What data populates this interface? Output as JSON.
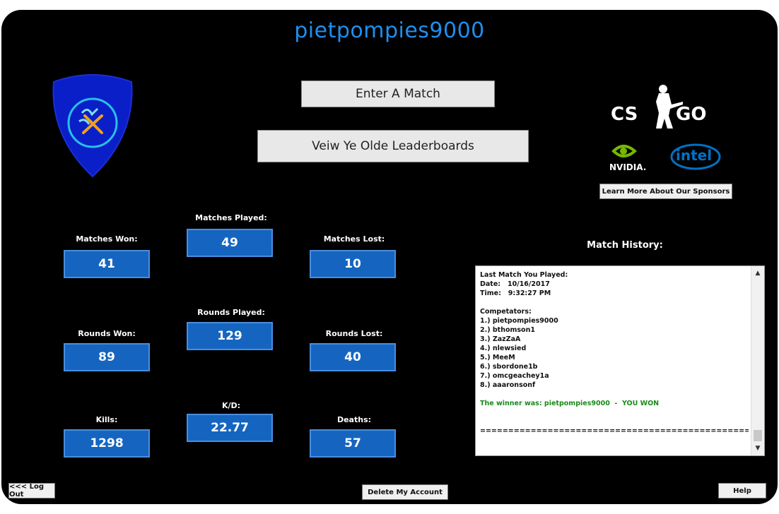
{
  "header": {
    "username": "pietpompies9000"
  },
  "actions": {
    "enter_match": "Enter A Match",
    "leaderboards": "Veiw Ye Olde Leaderboards",
    "sponsors": "Learn More About Our Sponsors",
    "logout": "<<< Log Out",
    "delete_account": "Delete My Account",
    "help": "Help"
  },
  "sponsors": {
    "game": "CS GO",
    "nvidia": "NVIDIA.",
    "intel": "intel"
  },
  "stats": {
    "matches_won": {
      "label": "Matches Won:",
      "value": "41"
    },
    "matches_played": {
      "label": "Matches Played:",
      "value": "49"
    },
    "matches_lost": {
      "label": "Matches Lost:",
      "value": "10"
    },
    "rounds_won": {
      "label": "Rounds Won:",
      "value": "89"
    },
    "rounds_played": {
      "label": "Rounds Played:",
      "value": "129"
    },
    "rounds_lost": {
      "label": "Rounds Lost:",
      "value": "40"
    },
    "kills": {
      "label": "Kills:",
      "value": "1298"
    },
    "kd": {
      "label": "K/D:",
      "value": "22.77"
    },
    "deaths": {
      "label": "Deaths:",
      "value": "57"
    }
  },
  "history": {
    "title": "Match History:",
    "lines": [
      "Last Match You Played:",
      "Date:   10/16/2017",
      "Time:   9:32:27 PM",
      "",
      "Competators:",
      "1.) pietpompies9000",
      "2.) bthomson1",
      "3.) ZazZaA",
      "4.) nlewsied",
      "5.) MeeM",
      "6.) sbordone1b",
      "7.) omcgeachey1a",
      "8.) aaaronsonf",
      "",
      "The winner was: pietpompies9000  -  YOU WON",
      "",
      "",
      "================================================="
    ]
  },
  "colors": {
    "accent": "#1f8ff0",
    "stat_box": "#1565c0",
    "win_text": "#1a8a1a",
    "shield": "#0a1fc8"
  }
}
